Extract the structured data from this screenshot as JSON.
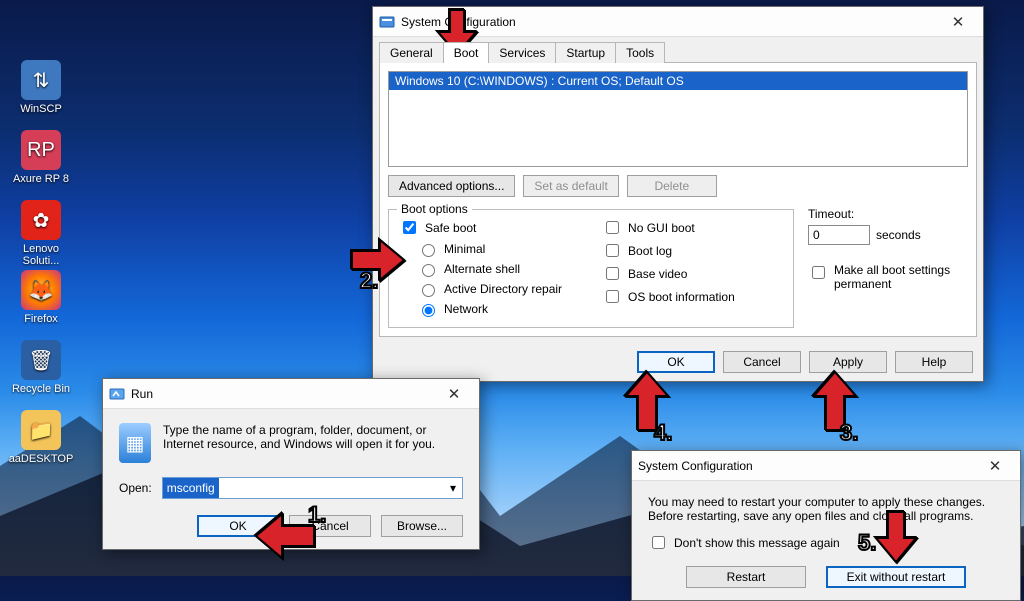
{
  "desktop": {
    "icons": [
      {
        "label": "WinSCP"
      },
      {
        "label": "Axure RP 8"
      },
      {
        "label": "Lenovo Soluti..."
      },
      {
        "label": "Firefox"
      },
      {
        "label": "Recycle Bin"
      },
      {
        "label": "aaDESKTOP"
      }
    ]
  },
  "msconfig": {
    "title": "System Configuration",
    "tabs": [
      "General",
      "Boot",
      "Services",
      "Startup",
      "Tools"
    ],
    "active_tab": "Boot",
    "os_selected": "Windows 10 (C:\\WINDOWS) : Current OS; Default OS",
    "advanced_btn": "Advanced options...",
    "set_default_btn": "Set as default",
    "delete_btn": "Delete",
    "boot_group": "Boot options",
    "safe_boot": "Safe boot",
    "safe_modes": [
      "Minimal",
      "Alternate shell",
      "Active Directory repair",
      "Network"
    ],
    "safe_selected": "Network",
    "right_checks": [
      "No GUI boot",
      "Boot log",
      "Base video",
      "OS boot information"
    ],
    "timeout_label": "Timeout:",
    "timeout_value": "0",
    "timeout_unit": "seconds",
    "permanent": "Make all boot settings permanent",
    "footer": {
      "ok": "OK",
      "cancel": "Cancel",
      "apply": "Apply",
      "help": "Help"
    }
  },
  "run": {
    "title": "Run",
    "hint": "Type the name of a program, folder, document, or Internet resource, and Windows will open it for you.",
    "open_label": "Open:",
    "value": "msconfig",
    "ok": "OK",
    "cancel": "Cancel",
    "browse": "Browse..."
  },
  "restart": {
    "title": "System Configuration",
    "msg1": "You may need to restart your computer to apply these changes.",
    "msg2": "Before restarting, save any open files and close all programs.",
    "dont_show": "Don't show this message again",
    "restart_btn": "Restart",
    "exit_btn": "Exit without restart"
  },
  "annotations": {
    "n1": "1.",
    "n2": "2.",
    "n3": "3.",
    "n4": "4.",
    "n5": "5."
  }
}
